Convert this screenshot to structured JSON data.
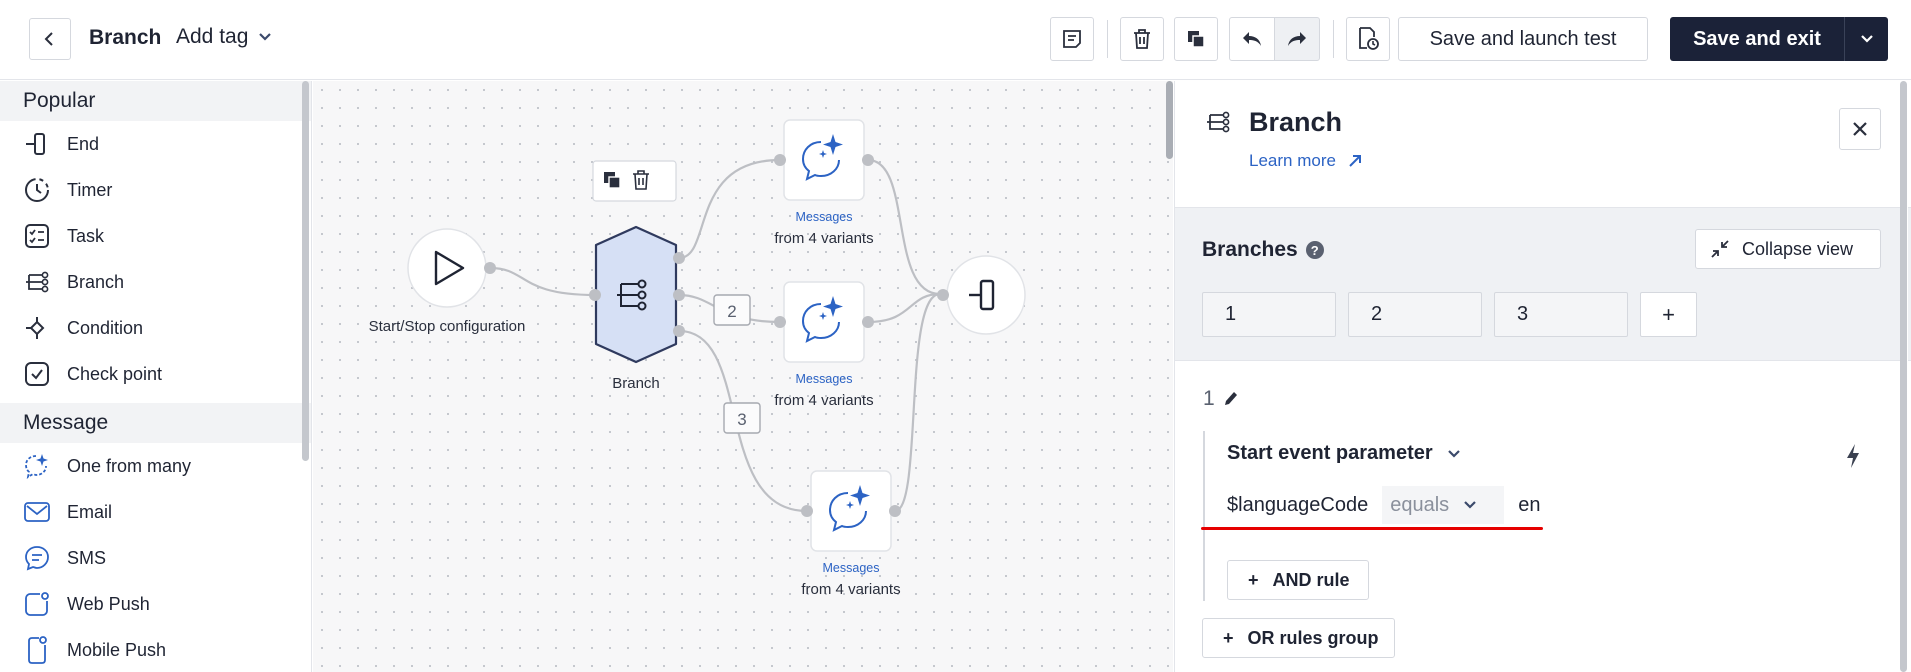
{
  "header": {
    "back_icon": "chevron-left-icon",
    "title": "Branch",
    "tag_label": "Add tag",
    "launch_label": "Save and launch test",
    "exit_label": "Save and exit"
  },
  "sidebar": {
    "sections": [
      {
        "title": "Popular",
        "items": [
          {
            "label": "End",
            "icon": "end-icon"
          },
          {
            "label": "Timer",
            "icon": "timer-icon"
          },
          {
            "label": "Task",
            "icon": "task-icon"
          },
          {
            "label": "Branch",
            "icon": "branch-icon"
          },
          {
            "label": "Condition",
            "icon": "condition-icon"
          },
          {
            "label": "Check point",
            "icon": "checkpoint-icon"
          }
        ]
      },
      {
        "title": "Message",
        "items": [
          {
            "label": "One from many",
            "icon": "sparkle-chat-icon"
          },
          {
            "label": "Email",
            "icon": "email-icon"
          },
          {
            "label": "SMS",
            "icon": "sms-icon"
          },
          {
            "label": "Web Push",
            "icon": "web-push-icon"
          },
          {
            "label": "Mobile Push",
            "icon": "mobile-push-icon"
          }
        ]
      }
    ]
  },
  "canvas": {
    "start_label": "Start/Stop configuration",
    "branch_label": "Branch",
    "message_nodes": [
      {
        "type": "Messages",
        "sub": "from 4 variants"
      },
      {
        "type": "Messages",
        "sub": "from 4 variants"
      },
      {
        "type": "Messages",
        "sub": "from 4 variants"
      }
    ],
    "edge_labels": [
      "2",
      "3"
    ]
  },
  "panel": {
    "title": "Branch",
    "learn_more": "Learn more",
    "branches_title": "Branches",
    "help_glyph": "?",
    "collapse_label": "Collapse view",
    "branch_tabs": [
      "1",
      "2",
      "3"
    ],
    "add_glyph": "+",
    "current_branch": "1",
    "rule_title": "Start event parameter",
    "condition": {
      "variable": "$languageCode",
      "operator": "equals",
      "value": "en"
    },
    "and_rule_label": "AND rule",
    "or_group_label": "OR rules group"
  },
  "colors": {
    "accent": "#2c63c4",
    "primary_button": "#1b2238",
    "highlight_underline": "#e60000",
    "branch_node_fill": "#d6e0f5"
  }
}
